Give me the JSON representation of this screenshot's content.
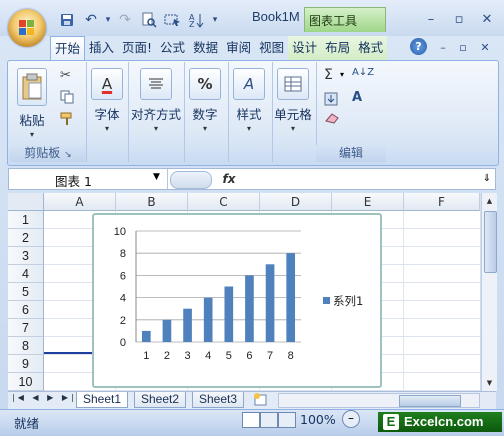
{
  "window": {
    "title": "Book1M",
    "context_tool_label": "图表工具",
    "minimize": "–",
    "restore": "▫",
    "close": "✕"
  },
  "quick_access": {
    "save_icon": "save-icon",
    "undo": "↶",
    "redo": "↷",
    "dropdown": "▾"
  },
  "tabs": [
    "开始",
    "插入",
    "页面!",
    "公式",
    "数据",
    "审阅",
    "视图",
    "设计",
    "布局",
    "格式"
  ],
  "ribbon_controls": {
    "help": "?",
    "minimize": "–",
    "restore": "▫",
    "close": "✕"
  },
  "ribbon": {
    "clipboard": {
      "paste_label": "粘贴",
      "group_label": "剪贴板"
    },
    "font": {
      "label": "字体",
      "icon_text": "A"
    },
    "alignment": {
      "label": "对齐方式"
    },
    "number": {
      "label": "数字",
      "icon_text": "%"
    },
    "styles": {
      "label": "样式",
      "icon_text": "A"
    },
    "cells": {
      "label": "单元格"
    },
    "editing": {
      "group_label": "编辑",
      "sum": "Σ",
      "sort": "A↓Z",
      "find": "A"
    }
  },
  "formula_bar": {
    "name_box": "图表 1",
    "fx": "fx"
  },
  "columns": [
    "A",
    "B",
    "C",
    "D",
    "E",
    "F"
  ],
  "rows": [
    "1",
    "2",
    "3",
    "4",
    "5",
    "6",
    "7",
    "8",
    "9",
    "10"
  ],
  "sheets": [
    "Sheet1",
    "Sheet2",
    "Sheet3"
  ],
  "sheet_nav": [
    "|◀",
    "◀",
    "▶",
    "▶|"
  ],
  "status": {
    "ready": "就绪",
    "zoom": "100%",
    "zoom_out": "–",
    "site_label": "Excelcn.com"
  },
  "chart_data": {
    "type": "bar",
    "categories": [
      "1",
      "2",
      "3",
      "4",
      "5",
      "6",
      "7",
      "8"
    ],
    "series": [
      {
        "name": "系列1",
        "values": [
          1,
          2,
          3,
          4,
          5,
          6,
          7,
          8
        ],
        "color": "#4f81bd"
      }
    ],
    "y_ticks": [
      "0",
      "2",
      "4",
      "6",
      "8",
      "10"
    ],
    "ylim": [
      0,
      10
    ],
    "grid": true,
    "legend": "right"
  }
}
